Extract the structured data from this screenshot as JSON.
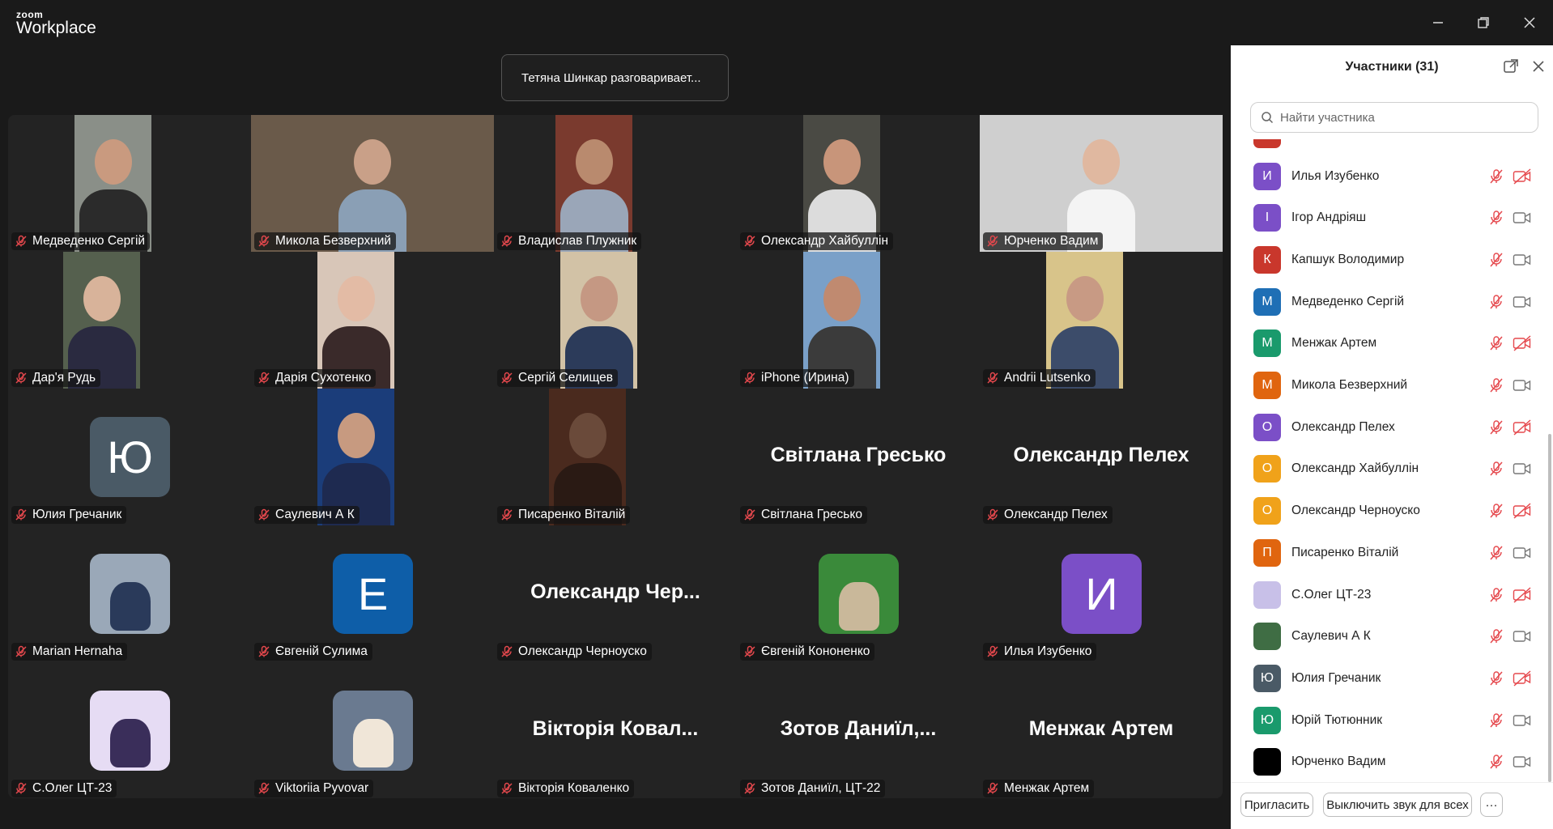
{
  "app": {
    "brand_small": "zoom",
    "brand_large": "Workplace"
  },
  "toast": {
    "text": "Тетяна Шинкар разговаривает..."
  },
  "tiles": [
    {
      "name": "Медведенко Сергій"
    },
    {
      "name": "Микола Безверхний"
    },
    {
      "name": "Владислав Плужник"
    },
    {
      "name": "Олександр Хайбуллін"
    },
    {
      "name": "Юрченко Вадим"
    },
    {
      "name": "Дар'я Рудь"
    },
    {
      "name": "Дарія Сухотенко"
    },
    {
      "name": "Сергій Селищев"
    },
    {
      "name": "iPhone (Ирина)"
    },
    {
      "name": "Andrii Lutsenko"
    },
    {
      "name": "Юлия Гречаник",
      "avatar_letter": "Ю"
    },
    {
      "name": "Саулевич А К"
    },
    {
      "name": "Писаренко Віталій"
    },
    {
      "name": "Світлана Гресько",
      "big_name": "Світлана  Гресько"
    },
    {
      "name": "Олександр Пелех",
      "big_name": "Олександр Пелех"
    },
    {
      "name": "Marian Hernaha"
    },
    {
      "name": "Євгеній Сулима",
      "avatar_letter": "E"
    },
    {
      "name": "Олександр Черноуско",
      "big_name": "Олександр  Чер..."
    },
    {
      "name": "Євгеній Кононенко"
    },
    {
      "name": "Илья Изубенко",
      "avatar_letter": "И"
    },
    {
      "name": "С.Олег ЦТ-23"
    },
    {
      "name": "Viktoriia Pyvovar"
    },
    {
      "name": "Вікторія Коваленко",
      "big_name": "Вікторія  Ковал..."
    },
    {
      "name": "Зотов Даниїл, ЦТ-22",
      "big_name": "Зотов  Даниїл,..."
    },
    {
      "name": "Менжак Артем",
      "big_name": "Менжак Артем"
    }
  ],
  "panel": {
    "title": "Участники (31)",
    "search_placeholder": "Найти участника",
    "participants": [
      {
        "letter": "И",
        "name": "Илья Изубенко",
        "color": "#7b4fc7",
        "cam_off": true
      },
      {
        "letter": "І",
        "name": "Ігор Андріяш",
        "color": "#7b4fc7",
        "cam_off": false
      },
      {
        "letter": "К",
        "name": "Капшук Володимир",
        "color": "#c9372c",
        "cam_off": false
      },
      {
        "letter": "М",
        "name": "Медведенко Сергій",
        "color": "#1f6fb5",
        "cam_off": false
      },
      {
        "letter": "М",
        "name": "Менжак Артем",
        "color": "#1a9a6c",
        "cam_off": true
      },
      {
        "letter": "М",
        "name": "Микола Безверхний",
        "color": "#e0650f",
        "cam_off": false
      },
      {
        "letter": "О",
        "name": "Олександр Пелех",
        "color": "#7b4fc7",
        "cam_off": true
      },
      {
        "letter": "О",
        "name": "Олександр Хайбуллін",
        "color": "#f0a21a",
        "cam_off": false
      },
      {
        "letter": "О",
        "name": "Олександр Черноуско",
        "color": "#f0a21a",
        "cam_off": true
      },
      {
        "letter": "П",
        "name": "Писаренко Віталій",
        "color": "#e0650f",
        "cam_off": false
      },
      {
        "letter": "",
        "name": "С.Олег ЦТ-23",
        "color": "#c8c0e8",
        "cam_off": true
      },
      {
        "letter": "",
        "name": "Саулевич А К",
        "color": "#3f6d44",
        "cam_off": false
      },
      {
        "letter": "Ю",
        "name": "Юлия Гречаник",
        "color": "#4a5a66",
        "cam_off": true
      },
      {
        "letter": "Ю",
        "name": "Юрій Тютюнник",
        "color": "#1a9a6c",
        "cam_off": false
      },
      {
        "letter": "",
        "name": "Юрченко Вадим",
        "color": "#000000",
        "cam_off": false
      }
    ],
    "invite_label": "Пригласить",
    "mute_all_label": "Выключить звук для всех",
    "more_label": "···"
  }
}
